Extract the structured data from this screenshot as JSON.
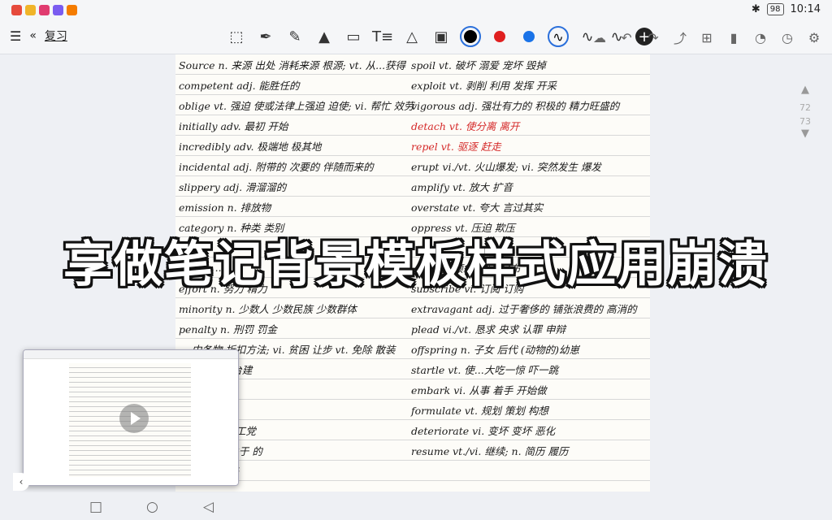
{
  "status_bar": {
    "app_icons": [
      {
        "name": "video-app-icon",
        "color": "#e64a3c"
      },
      {
        "name": "emoji-app-icon",
        "color": "#f0b429"
      },
      {
        "name": "gallery-app-icon",
        "color": "#e03b6f"
      },
      {
        "name": "browser-app-icon",
        "color": "#7a5cf0"
      },
      {
        "name": "video-player-app-icon",
        "color": "#f57c00"
      }
    ],
    "battery": "98",
    "time": "10:14"
  },
  "toolbar": {
    "back_label": "复习",
    "colors": [
      {
        "name": "black",
        "hex": "#000000",
        "selected": true
      },
      {
        "name": "red",
        "hex": "#e02020",
        "selected": false
      },
      {
        "name": "blue",
        "hex": "#1a73e8",
        "selected": false
      }
    ]
  },
  "scroller": {
    "page_current": "72",
    "page_next": "73"
  },
  "overlay_title": "享做笔记背景模板样式应用崩溃",
  "vocab_left": [
    {
      "text": "Source  n. 来源 出处 消耗来源 根源; vt. 从...获得"
    },
    {
      "text": "competent  adj. 能胜任的"
    },
    {
      "text": "oblige  vt. 强迫 使或法律上强迫 迫使; vi. 帮忙 效劳"
    },
    {
      "text": "initially  adv. 最初 开始"
    },
    {
      "text": "incredibly  adv. 极端地 极其地"
    },
    {
      "text": "incidental  adj. 附带的 次要的 伴随而来的"
    },
    {
      "text": "slippery  adj. 滑溜溜的"
    },
    {
      "text": "emission  n. 排放物"
    },
    {
      "text": "category  n. 种类 类别"
    },
    {
      "text": ""
    },
    {
      "text": "buzzle  ..."
    },
    {
      "text": "effort  n. 努力 精力"
    },
    {
      "text": "minority  n. 少数人 少数民族 少数群体"
    },
    {
      "text": "penalty  n. 刑罚 罚金"
    },
    {
      "text": "...  中各物 折扣方法; vi. 贫困 让步 vt. 免除 散装"
    },
    {
      "text": "...  户 帐 回 台建"
    },
    {
      "text": "...  宴会"
    },
    {
      "text": "...  绘画 画廊"
    },
    {
      "text": "...  劳动 英国工党"
    },
    {
      "text": "...  属 附物 关于 的"
    },
    {
      "text": "...  人 居住 于"
    }
  ],
  "vocab_right": [
    {
      "text": "spoil  vt. 破坏 溺爱 宠坏 毁掉",
      "color": "black"
    },
    {
      "text": "exploit  vt. 剥削 利用 发挥 开采",
      "color": "black"
    },
    {
      "text": "vigorous  adj. 强壮有力的 积极的 精力旺盛的",
      "color": "black"
    },
    {
      "text": "detach  vt. 使分离 离开",
      "color": "red"
    },
    {
      "text": "repel  vt. 驱逐 赶走",
      "color": "red"
    },
    {
      "text": "erupt  vi./vt. 火山爆发; vi. 突然发生 爆发",
      "color": "black"
    },
    {
      "text": "amplify  vt. 放大 扩音",
      "color": "black"
    },
    {
      "text": "overstate  vt. 夸大 言过其实",
      "color": "black"
    },
    {
      "text": "oppress  vt. 压迫 欺压",
      "color": "black"
    },
    {
      "text": "",
      "color": "black"
    },
    {
      "text": "...  vi. 使 倾斜 被压 分布",
      "color": "black"
    },
    {
      "text": "subscribe  vi. 订阅 订购",
      "color": "black"
    },
    {
      "text": "extravagant  adj. 过于奢侈的 铺张浪费的 高消的",
      "color": "black"
    },
    {
      "text": "plead  vi./vt. 恳求 央求 认罪 申辩",
      "color": "black"
    },
    {
      "text": "offspring  n. 子女 后代 (动物的)幼崽",
      "color": "black"
    },
    {
      "text": "startle  vt. 使...大吃一惊 吓一跳",
      "color": "black"
    },
    {
      "text": "embark  vi. 从事 着手 开始做",
      "color": "black"
    },
    {
      "text": "formulate  vt. 规划 策划 构想",
      "color": "black"
    },
    {
      "text": "deteriorate  vi. 变坏 变坏 恶化",
      "color": "black"
    },
    {
      "text": "resume  vt./vi. 继续; n. 简历 履历",
      "color": "black"
    }
  ]
}
